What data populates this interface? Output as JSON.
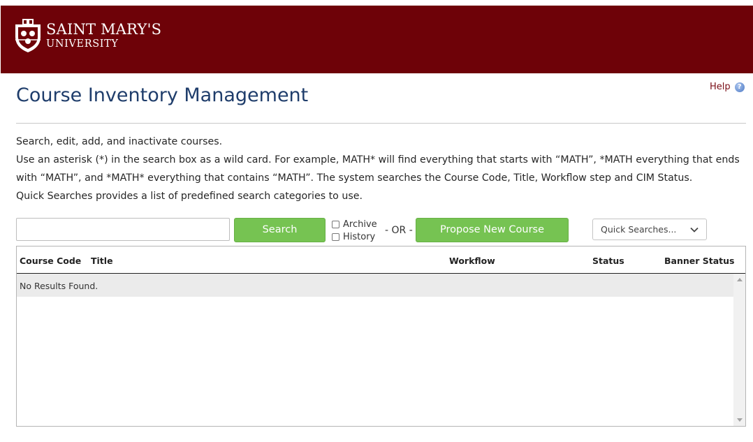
{
  "header": {
    "logo_line1": "SAINT MARY'S",
    "logo_line2": "UNIVERSITY",
    "brand_color": "#6e0208"
  },
  "page": {
    "title": "Course Inventory Management",
    "help_label": "Help",
    "help_icon_glyph": "?"
  },
  "instructions": [
    "Search, edit, add, and inactivate courses.",
    "Use an asterisk (*) in the search box as a wild card. For example, MATH* will find everything that starts with “MATH”, *MATH everything that ends with “MATH”, and *MATH* everything that contains “MATH”. The system searches the Course Code, Title, Workflow step and CIM Status.",
    "Quick Searches provides a list of predefined search categories to use."
  ],
  "toolbar": {
    "search_value": "",
    "search_label": "Search",
    "archive_label": "Archive",
    "history_label": "History",
    "or_label": "- OR -",
    "propose_label": "Propose New Course",
    "quick_searches_label": "Quick Searches...",
    "button_color": "#76c352"
  },
  "results": {
    "columns": {
      "course_code": "Course Code",
      "title": "Title",
      "workflow": "Workflow",
      "status": "Status",
      "banner_status": "Banner Status"
    },
    "empty_message": "No Results Found."
  }
}
